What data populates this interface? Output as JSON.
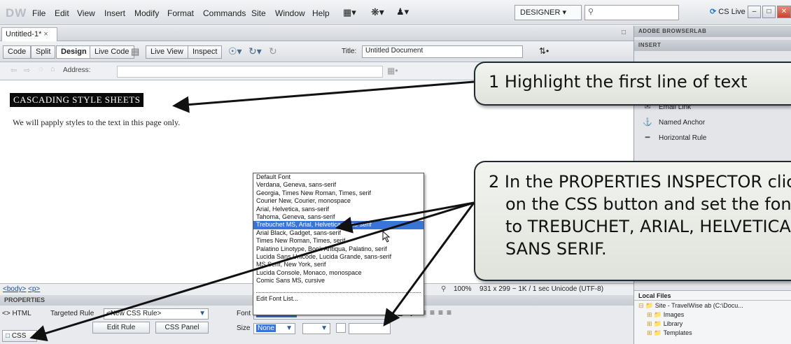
{
  "app": {
    "logo": "DW",
    "menu": [
      "File",
      "Edit",
      "View",
      "Insert",
      "Modify",
      "Format",
      "Commands",
      "Site",
      "Window",
      "Help"
    ],
    "workspace": "DESIGNER",
    "cslive": "CS Live"
  },
  "document": {
    "tab": "Untitled-1*",
    "view_buttons": [
      "Code",
      "Split",
      "Design",
      "Live Code",
      "Live View",
      "Inspect"
    ],
    "title_label": "Title:",
    "title_value": "Untitled Document",
    "address_label": "Address:"
  },
  "page": {
    "heading": "CASCADING STYLE SHEETS",
    "paragraph": "We will papply styles to the text in this page only."
  },
  "statusbar": {
    "tags": [
      "<body>",
      "<p>"
    ],
    "zoom": "100%",
    "info": "931 x 299 ~ 1K / 1 sec  Unicode (UTF-8)"
  },
  "properties": {
    "header": "PROPERTIES",
    "html_btn": "<> HTML",
    "css_btn": "CSS",
    "target_rule_label": "Targeted Rule",
    "target_rule_value": "<New CSS Rule>",
    "edit_rule": "Edit Rule",
    "css_panel": "CSS Panel",
    "font_label": "Font",
    "font_value": "Default Font",
    "size_label": "Size",
    "size_value": "None",
    "bold": "B",
    "italic": "I"
  },
  "font_menu": {
    "options": [
      "Default Font",
      "Verdana, Geneva, sans-serif",
      "Georgia, Times New Roman, Times, serif",
      "Courier New, Courier, monospace",
      "Arial, Helvetica, sans-serif",
      "Tahoma, Geneva, sans-serif",
      "Trebuchet MS, Arial, Helvetica, sans-serif",
      "Arial Black, Gadget, sans-serif",
      "Times New Roman, Times, serif",
      "Palatino Linotype, Book Antiqua, Palatino, serif",
      "Lucida Sans Unicode, Lucida Grande, sans-serif",
      "MS Serif, New York, serif",
      "Lucida Console, Monaco, monospace",
      "Comic Sans MS, cursive"
    ],
    "selected_index": 6,
    "edit_list": "Edit Font List..."
  },
  "right_panel": {
    "browserlab": "ADOBE BROWSERLAB",
    "insert": "INSERT",
    "insert_items": [
      "Email Link",
      "Named Anchor",
      "Horizontal Rule"
    ],
    "files_header": "Local Files",
    "files": [
      "Site - TravelWise ab (C:\\Docu...",
      "Images",
      "Library",
      "Templates"
    ]
  },
  "callouts": {
    "c1": "1  Highlight the first line of text",
    "c2": [
      "2  In the PROPERTIES INSPECTOR click",
      "on the CSS button and set the font",
      "to TREBUCHET, ARIAL, HELVETICA,",
      "SANS SERIF."
    ]
  },
  "colors": {
    "selection": "#3875d7",
    "callout_border": "#1f2a33"
  }
}
